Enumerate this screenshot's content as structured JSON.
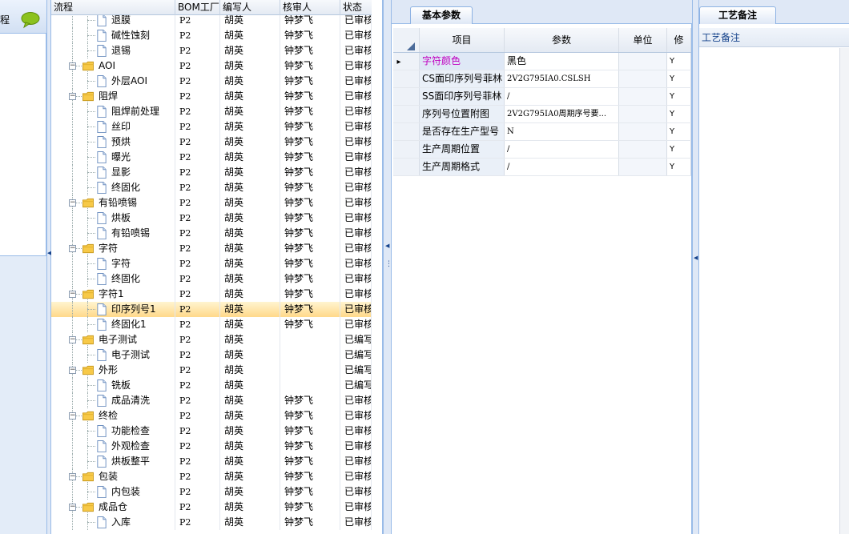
{
  "left_strip": {
    "title_fragment": "程",
    "icon": "chat-bubble-icon",
    "accent": "#7aa900"
  },
  "tree": {
    "columns": [
      "流程",
      "BOM工厂",
      "编写人",
      "核审人",
      "状态"
    ],
    "rows": [
      {
        "name": "退膜",
        "type": "doc",
        "level": 2,
        "bom": "P2",
        "author": "胡英",
        "reviewer": "钟梦飞",
        "status": "已审核"
      },
      {
        "name": "碱性蚀刻",
        "type": "doc",
        "level": 2,
        "bom": "P2",
        "author": "胡英",
        "reviewer": "钟梦飞",
        "status": "已审核"
      },
      {
        "name": "退锡",
        "type": "doc",
        "level": 2,
        "bom": "P2",
        "author": "胡英",
        "reviewer": "钟梦飞",
        "status": "已审核"
      },
      {
        "name": "AOI",
        "type": "folder",
        "level": 1,
        "bom": "P2",
        "author": "胡英",
        "reviewer": "钟梦飞",
        "status": "已审核"
      },
      {
        "name": "外层AOI",
        "type": "doc",
        "level": 2,
        "bom": "P2",
        "author": "胡英",
        "reviewer": "钟梦飞",
        "status": "已审核"
      },
      {
        "name": "阻焊",
        "type": "folder",
        "level": 1,
        "bom": "P2",
        "author": "胡英",
        "reviewer": "钟梦飞",
        "status": "已审核"
      },
      {
        "name": "阻焊前处理",
        "type": "doc",
        "level": 2,
        "bom": "P2",
        "author": "胡英",
        "reviewer": "钟梦飞",
        "status": "已审核"
      },
      {
        "name": "丝印",
        "type": "doc",
        "level": 2,
        "bom": "P2",
        "author": "胡英",
        "reviewer": "钟梦飞",
        "status": "已审核"
      },
      {
        "name": "预烘",
        "type": "doc",
        "level": 2,
        "bom": "P2",
        "author": "胡英",
        "reviewer": "钟梦飞",
        "status": "已审核"
      },
      {
        "name": "曝光",
        "type": "doc",
        "level": 2,
        "bom": "P2",
        "author": "胡英",
        "reviewer": "钟梦飞",
        "status": "已审核"
      },
      {
        "name": "显影",
        "type": "doc",
        "level": 2,
        "bom": "P2",
        "author": "胡英",
        "reviewer": "钟梦飞",
        "status": "已审核"
      },
      {
        "name": "终固化",
        "type": "doc",
        "level": 2,
        "bom": "P2",
        "author": "胡英",
        "reviewer": "钟梦飞",
        "status": "已审核"
      },
      {
        "name": "有铅喷锡",
        "type": "folder",
        "level": 1,
        "bom": "P2",
        "author": "胡英",
        "reviewer": "钟梦飞",
        "status": "已审核"
      },
      {
        "name": "烘板",
        "type": "doc",
        "level": 2,
        "bom": "P2",
        "author": "胡英",
        "reviewer": "钟梦飞",
        "status": "已审核"
      },
      {
        "name": "有铅喷锡",
        "type": "doc",
        "level": 2,
        "bom": "P2",
        "author": "胡英",
        "reviewer": "钟梦飞",
        "status": "已审核"
      },
      {
        "name": "字符",
        "type": "folder",
        "level": 1,
        "bom": "P2",
        "author": "胡英",
        "reviewer": "钟梦飞",
        "status": "已审核"
      },
      {
        "name": "字符",
        "type": "doc",
        "level": 2,
        "bom": "P2",
        "author": "胡英",
        "reviewer": "钟梦飞",
        "status": "已审核"
      },
      {
        "name": "终固化",
        "type": "doc",
        "level": 2,
        "bom": "P2",
        "author": "胡英",
        "reviewer": "钟梦飞",
        "status": "已审核"
      },
      {
        "name": "字符1",
        "type": "folder",
        "level": 1,
        "bom": "P2",
        "author": "胡英",
        "reviewer": "钟梦飞",
        "status": "已审核"
      },
      {
        "name": "印序列号1",
        "type": "doc",
        "level": 2,
        "bom": "P2",
        "author": "胡英",
        "reviewer": "钟梦飞",
        "status": "已审核",
        "selected": true
      },
      {
        "name": "终固化1",
        "type": "doc",
        "level": 2,
        "bom": "P2",
        "author": "胡英",
        "reviewer": "钟梦飞",
        "status": "已审核"
      },
      {
        "name": "电子测试",
        "type": "folder",
        "level": 1,
        "bom": "P2",
        "author": "胡英",
        "reviewer": "",
        "status": "已编写"
      },
      {
        "name": "电子测试",
        "type": "doc",
        "level": 2,
        "bom": "P2",
        "author": "胡英",
        "reviewer": "",
        "status": "已编写"
      },
      {
        "name": "外形",
        "type": "folder",
        "level": 1,
        "bom": "P2",
        "author": "胡英",
        "reviewer": "",
        "status": "已编写"
      },
      {
        "name": "铣板",
        "type": "doc",
        "level": 2,
        "bom": "P2",
        "author": "胡英",
        "reviewer": "",
        "status": "已编写"
      },
      {
        "name": "成品清洗",
        "type": "doc",
        "level": 2,
        "bom": "P2",
        "author": "胡英",
        "reviewer": "钟梦飞",
        "status": "已审核"
      },
      {
        "name": "终检",
        "type": "folder",
        "level": 1,
        "bom": "P2",
        "author": "胡英",
        "reviewer": "钟梦飞",
        "status": "已审核"
      },
      {
        "name": "功能检查",
        "type": "doc",
        "level": 2,
        "bom": "P2",
        "author": "胡英",
        "reviewer": "钟梦飞",
        "status": "已审核"
      },
      {
        "name": "外观检查",
        "type": "doc",
        "level": 2,
        "bom": "P2",
        "author": "胡英",
        "reviewer": "钟梦飞",
        "status": "已审核"
      },
      {
        "name": "烘板整平",
        "type": "doc",
        "level": 2,
        "bom": "P2",
        "author": "胡英",
        "reviewer": "钟梦飞",
        "status": "已审核"
      },
      {
        "name": "包装",
        "type": "folder",
        "level": 1,
        "bom": "P2",
        "author": "胡英",
        "reviewer": "钟梦飞",
        "status": "已审核"
      },
      {
        "name": "内包装",
        "type": "doc",
        "level": 2,
        "bom": "P2",
        "author": "胡英",
        "reviewer": "钟梦飞",
        "status": "已审核"
      },
      {
        "name": "成品仓",
        "type": "folder",
        "level": 1,
        "bom": "P2",
        "author": "胡英",
        "reviewer": "钟梦飞",
        "status": "已审核"
      },
      {
        "name": "入库",
        "type": "doc",
        "level": 2,
        "bom": "P2",
        "author": "胡英",
        "reviewer": "钟梦飞",
        "status": "已审核"
      }
    ]
  },
  "params": {
    "tab_label": "基本参数",
    "columns": [
      "项目",
      "参数",
      "单位",
      "修"
    ],
    "rows": [
      {
        "item": "字符颜色",
        "value": "黑色",
        "unit": "",
        "mod": "Y",
        "current": true,
        "mono": false
      },
      {
        "item": "CS面印序列号菲林",
        "value": "2V2G795IA0.CSLSH",
        "unit": "",
        "mod": "Y",
        "mono": true
      },
      {
        "item": "SS面印序列号菲林",
        "value": "/",
        "unit": "",
        "mod": "Y",
        "mono": true
      },
      {
        "item": "序列号位置附图",
        "value": "2V2G795IA0周期序号要...",
        "unit": "",
        "mod": "Y",
        "mono": true
      },
      {
        "item": "是否存在生产型号",
        "value": "N",
        "unit": "",
        "mod": "Y",
        "mono": true
      },
      {
        "item": "生产周期位置",
        "value": "/",
        "unit": "",
        "mod": "Y",
        "mono": true
      },
      {
        "item": "生产周期格式",
        "value": "/",
        "unit": "",
        "mod": "Y",
        "mono": true
      }
    ]
  },
  "notes": {
    "tab_label": "工艺备注",
    "header": "工艺备注"
  }
}
